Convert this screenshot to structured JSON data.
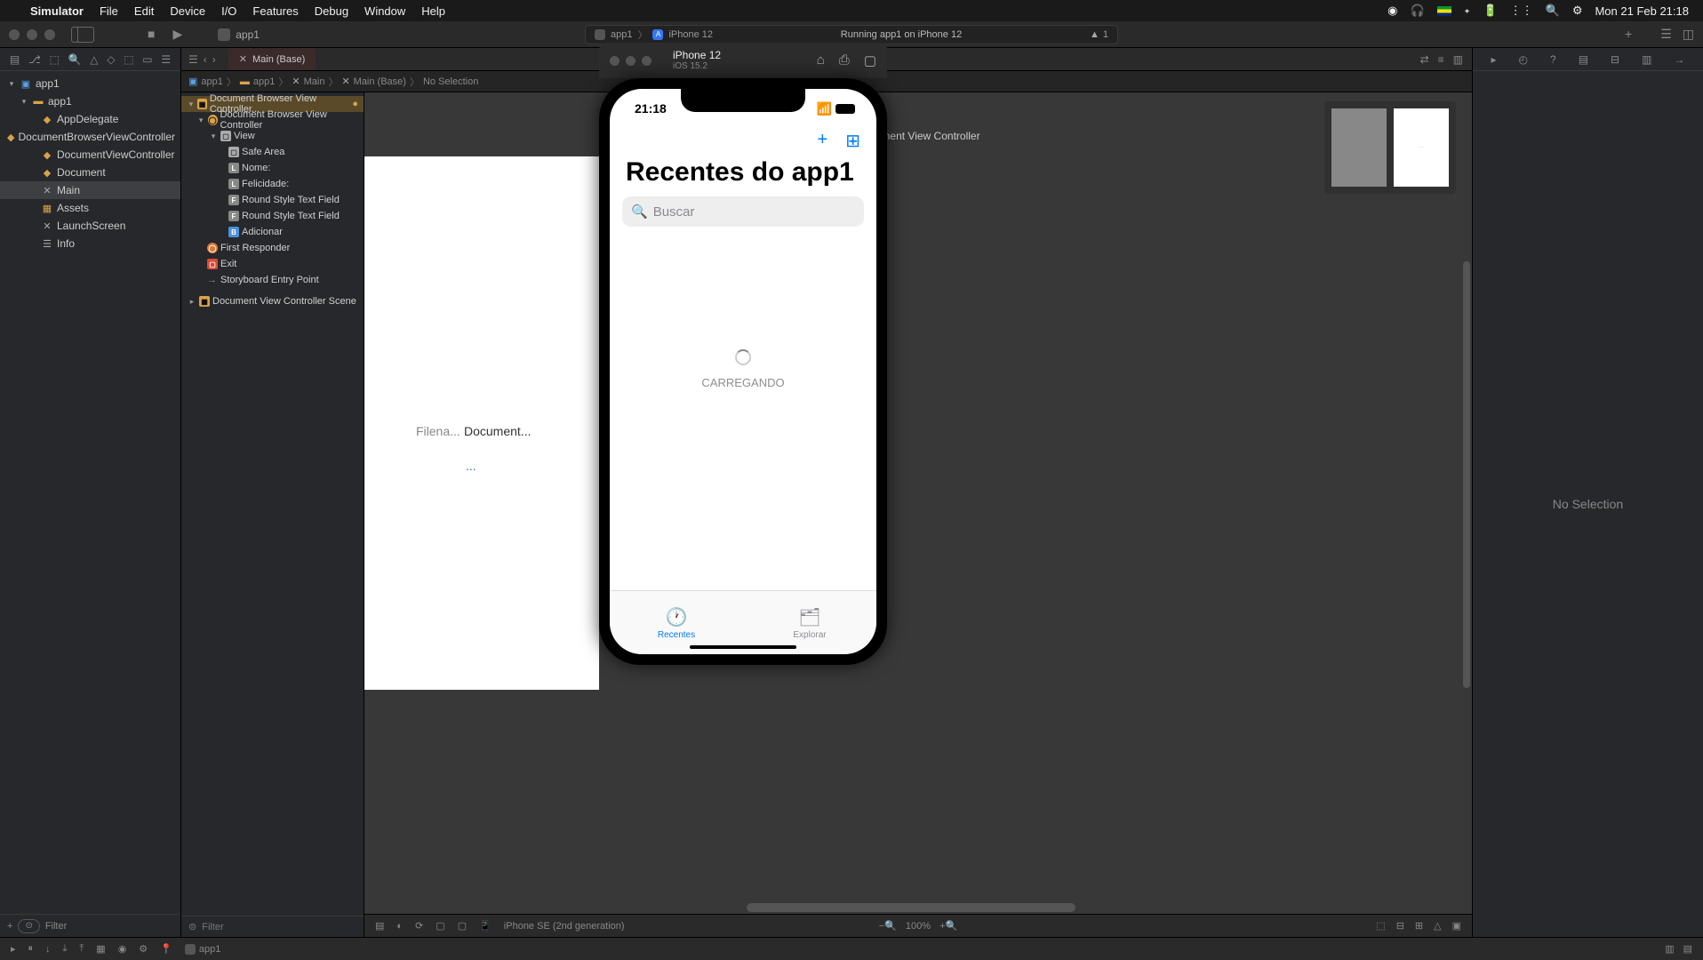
{
  "menubar": {
    "app": "Simulator",
    "items": [
      "File",
      "Edit",
      "Device",
      "I/O",
      "Features",
      "Debug",
      "Window",
      "Help"
    ],
    "clock": "Mon 21 Feb  21:18"
  },
  "xcode_toolbar": {
    "scheme": "app1",
    "status_scheme": "app1",
    "status_device": "iPhone 12",
    "status_text": "Running app1 on iPhone 12",
    "status_issue": "1"
  },
  "navigator": {
    "filter_placeholder": "Filter",
    "tree": {
      "root": "app1",
      "target": "app1",
      "items": [
        "AppDelegate",
        "DocumentBrowserViewController",
        "DocumentViewController",
        "Document",
        "Main",
        "Assets",
        "LaunchScreen",
        "Info"
      ]
    }
  },
  "tab": {
    "label": "Main (Base)"
  },
  "jumpbar": [
    "app1",
    "app1",
    "Main",
    "Main (Base)",
    "No Selection"
  ],
  "outline": {
    "filter_placeholder": "Filter",
    "scene1": "Document Browser View Controller...",
    "vc1": "Document Browser View Controller",
    "view": "View",
    "safe_area": "Safe Area",
    "nome": "Nome:",
    "felicidade": "Felicidade:",
    "tf1": "Round Style Text Field",
    "tf2": "Round Style Text Field",
    "adicionar": "Adicionar",
    "responder": "First Responder",
    "exit": "Exit",
    "entry": "Storyboard Entry Point",
    "scene2": "Document View Controller Scene"
  },
  "canvas": {
    "header": "Document View Controller",
    "label1": "Filena...",
    "label2": "Document...",
    "label3": "...",
    "device_label": "iPhone SE (2nd generation)",
    "zoom": "100%"
  },
  "inspector": {
    "empty": "No Selection"
  },
  "simulator": {
    "title": "iPhone 12",
    "subtitle": "iOS 15.2",
    "status_time": "21:18",
    "app_title": "Recentes do app1",
    "search_placeholder": "Buscar",
    "loading": "CARREGANDO",
    "tab_recent": "Recentes",
    "tab_explore": "Explorar"
  },
  "debug": {
    "target": "app1"
  }
}
